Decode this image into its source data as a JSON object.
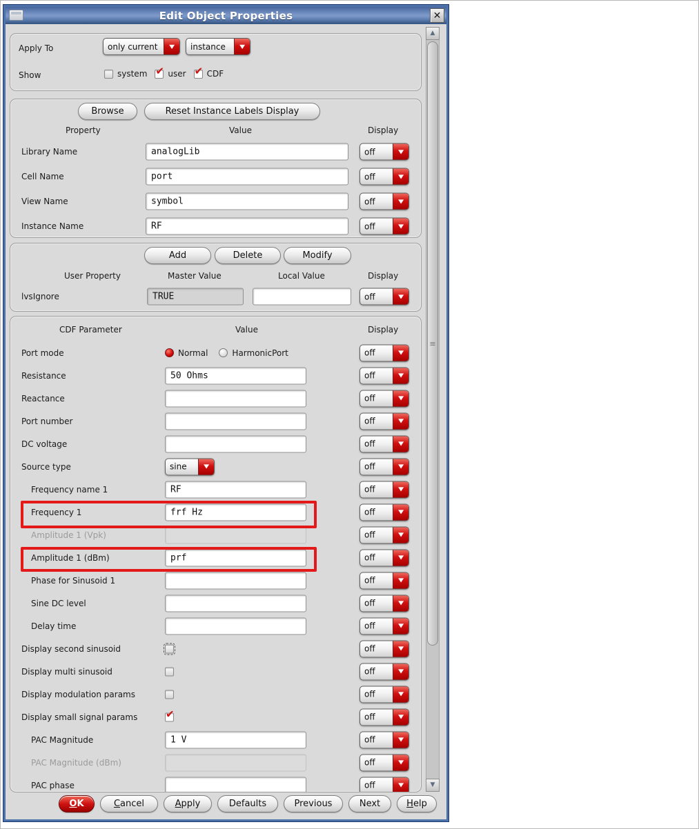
{
  "window": {
    "title": "Edit Object Properties"
  },
  "colors": {
    "accent_red": "#cc0000",
    "titlebar_blue": "#5b7cb2",
    "annotation_red": "#e41a1a"
  },
  "icons": {
    "close": "✕",
    "chevron_down": "▼",
    "scroll_up": "▲",
    "scroll_down": "▼",
    "check": "✔",
    "grip": "≡"
  },
  "apply_section": {
    "apply_to_label": "Apply To",
    "scope_value": "only current",
    "target_value": "instance",
    "show_label": "Show",
    "show_options": [
      {
        "label": "system",
        "checked": false
      },
      {
        "label": "user",
        "checked": true
      },
      {
        "label": "CDF",
        "checked": true
      }
    ]
  },
  "attributes_section": {
    "browse_button": "Browse",
    "reset_button": "Reset Instance Labels Display",
    "headers": {
      "property": "Property",
      "value": "Value",
      "display": "Display"
    },
    "rows": [
      {
        "label": "Library Name",
        "value": "analogLib",
        "display": "off"
      },
      {
        "label": "Cell Name",
        "value": "port",
        "display": "off"
      },
      {
        "label": "View Name",
        "value": "symbol",
        "display": "off"
      },
      {
        "label": "Instance Name",
        "value": "RF",
        "display": "off"
      }
    ]
  },
  "user_property_section": {
    "add_button": "Add",
    "delete_button": "Delete",
    "modify_button": "Modify",
    "headers": {
      "property": "User Property",
      "master": "Master Value",
      "local": "Local Value",
      "display": "Display"
    },
    "rows": [
      {
        "label": "lvsIgnore",
        "master_value": "TRUE",
        "local_value": "",
        "display": "off"
      }
    ]
  },
  "cdf_section": {
    "headers": {
      "param": "CDF Parameter",
      "value": "Value",
      "display": "Display"
    },
    "rows": [
      {
        "label": "Port mode",
        "type": "radio",
        "options": [
          "Normal",
          "HarmonicPort"
        ],
        "selected": "Normal",
        "display": "off"
      },
      {
        "label": "Resistance",
        "value": "50 Ohms",
        "display": "off"
      },
      {
        "label": "Reactance",
        "value": "",
        "display": "off"
      },
      {
        "label": "Port number",
        "value": "",
        "display": "off"
      },
      {
        "label": "DC voltage",
        "value": "",
        "display": "off"
      },
      {
        "label": "Source type",
        "type": "dropdown",
        "value": "sine",
        "display": "off"
      },
      {
        "label": "Frequency name 1",
        "value": "RF",
        "indent": true,
        "display": "off"
      },
      {
        "label": "Frequency 1",
        "value": "frf Hz",
        "indent": true,
        "highlighted": true,
        "display": "off"
      },
      {
        "label": "Amplitude 1 (Vpk)",
        "value": "",
        "indent": true,
        "disabled": true,
        "display": "off"
      },
      {
        "label": "Amplitude 1 (dBm)",
        "value": "prf",
        "indent": true,
        "highlighted": true,
        "display": "off"
      },
      {
        "label": "Phase for Sinusoid 1",
        "value": "",
        "indent": true,
        "display": "off"
      },
      {
        "label": "Sine DC level",
        "value": "",
        "indent": true,
        "display": "off"
      },
      {
        "label": "Delay time",
        "value": "",
        "indent": true,
        "display": "off"
      },
      {
        "label": "Display second sinusoid",
        "type": "checkbox",
        "checked": false,
        "focused": true,
        "display": "off"
      },
      {
        "label": "Display multi sinusoid",
        "type": "checkbox",
        "checked": false,
        "display": "off"
      },
      {
        "label": "Display modulation params",
        "type": "checkbox",
        "checked": false,
        "display": "off"
      },
      {
        "label": "Display small signal params",
        "type": "checkbox",
        "checked": true,
        "display": "off"
      },
      {
        "label": "PAC Magnitude",
        "value": "1 V",
        "indent": true,
        "display": "off"
      },
      {
        "label": "PAC Magnitude (dBm)",
        "value": "",
        "indent": true,
        "disabled": true,
        "display": "off"
      },
      {
        "label": "PAC phase",
        "value": "",
        "indent": true,
        "display": "off"
      }
    ]
  },
  "footer": {
    "buttons": [
      {
        "label": "OK",
        "underline_first": true,
        "primary": true
      },
      {
        "label": "Cancel",
        "underline_first": true
      },
      {
        "label": "Apply",
        "underline_first": true
      },
      {
        "label": "Defaults",
        "underline_first": false
      },
      {
        "label": "Previous",
        "underline_first": false
      },
      {
        "label": "Next",
        "underline_first": false
      },
      {
        "label": "Help",
        "underline_first": true
      }
    ]
  }
}
